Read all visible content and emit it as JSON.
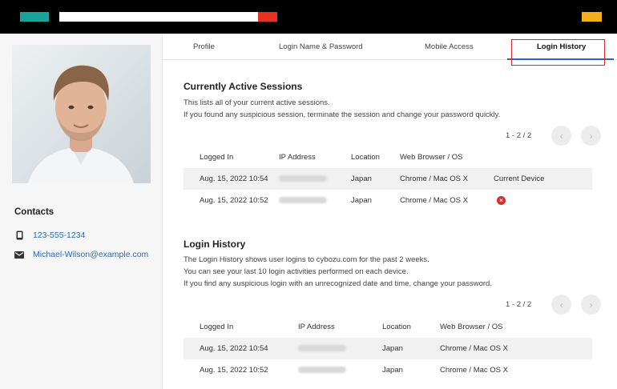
{
  "colors": {
    "accent": "#2a6ab4",
    "highlight": "#d92b2b",
    "danger": "#d62d2d",
    "top_bar": "#000000",
    "teal": "#1aa39a",
    "red": "#e63223",
    "yellow": "#f2b11c"
  },
  "sidebar": {
    "contacts_title": "Contacts",
    "phone": "123-555-1234",
    "email": "Michael-Wilson@example.com"
  },
  "tabs": [
    {
      "label": "Profile"
    },
    {
      "label": "Login Name & Password"
    },
    {
      "label": "Mobile Access"
    },
    {
      "label": "Login History",
      "active": true
    }
  ],
  "active_sessions": {
    "title": "Currently Active Sessions",
    "desc1": "This lists all of your current active sessions.",
    "desc2": "If you found any suspicious session, terminate the session and change your password quickly.",
    "pager": "1 - 2 / 2",
    "headers": {
      "logged_in": "Logged In",
      "ip": "IP Address",
      "location": "Location",
      "browser": "Web Browser / OS"
    },
    "rows": [
      {
        "logged_in": "Aug. 15, 2022 10:54",
        "location": "Japan",
        "browser": "Chrome / Mac OS X",
        "status": "Current Device"
      },
      {
        "logged_in": "Aug. 15, 2022 10:52",
        "location": "Japan",
        "browser": "Chrome / Mac OS X",
        "status": ""
      }
    ]
  },
  "login_history": {
    "title": "Login History",
    "desc1": "The Login History shows user logins to cybozu.com for the past 2 weeks.",
    "desc2": "You can see your last 10 login activities performed on each device.",
    "desc3": "If you find any suspicious login with an unrecognized date and time, change your password.",
    "pager": "1 - 2 / 2",
    "headers": {
      "logged_in": "Logged In",
      "ip": "IP Address",
      "location": "Location",
      "browser": "Web Browser / OS"
    },
    "rows": [
      {
        "logged_in": "Aug. 15, 2022 10:54",
        "location": "Japan",
        "browser": "Chrome / Mac OS X"
      },
      {
        "logged_in": "Aug. 15, 2022 10:52",
        "location": "Japan",
        "browser": "Chrome / Mac OS X"
      }
    ]
  }
}
